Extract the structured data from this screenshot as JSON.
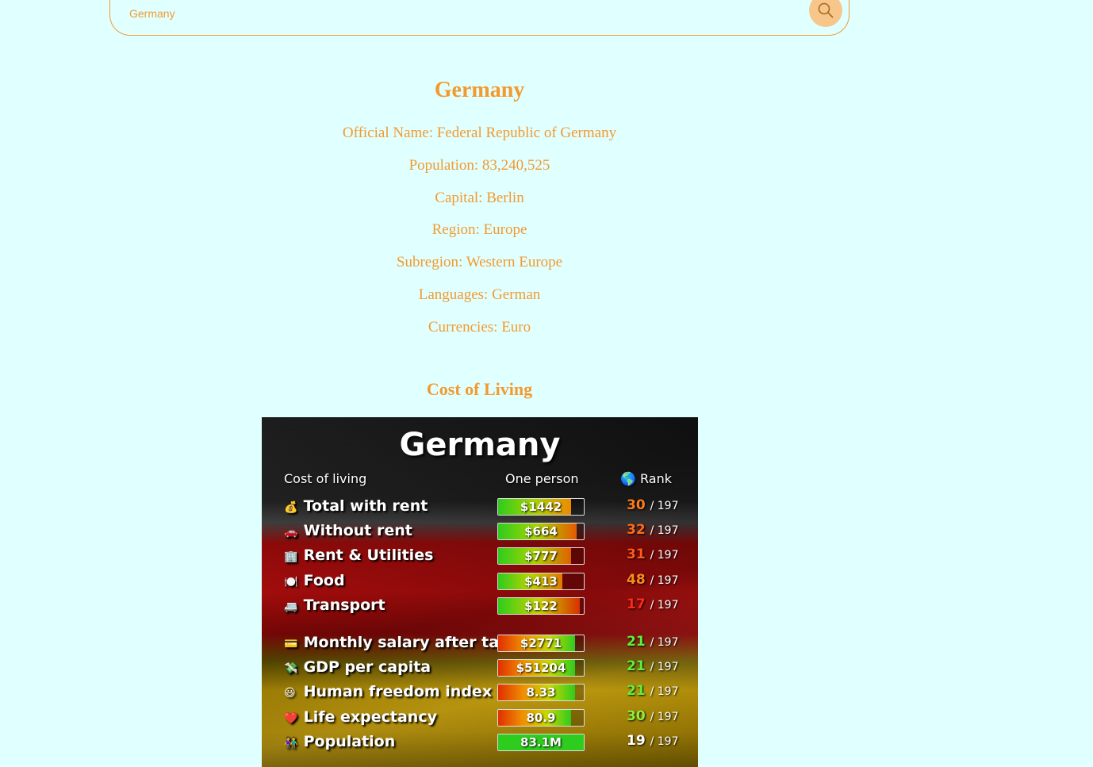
{
  "search": {
    "value": "Germany"
  },
  "country": {
    "name": "Germany",
    "official_name": "Official Name: Federal Republic of Germany",
    "population": "Population: 83,240,525",
    "capital": "Capital: Berlin",
    "region": "Region: Europe",
    "subregion": "Subregion: Western Europe",
    "languages": "Languages: German",
    "currencies": "Currencies: Euro"
  },
  "cost_section_title": "Cost of Living",
  "card": {
    "title": "Germany",
    "col_label": "Cost of living",
    "col_person": "One person",
    "col_rank": "Rank",
    "rows": [
      {
        "icon": "💰",
        "label": "Total with rent",
        "value": "$1442",
        "rank": "30",
        "of": "/ 197",
        "fill": 0.85,
        "rank_color": "#ff7a1a",
        "grad": "linear-gradient(90deg,#2ecc1e,#a8d400,#f08a00)"
      },
      {
        "icon": "🚗",
        "label": "Without rent",
        "value": "$664",
        "rank": "32",
        "of": "/ 197",
        "fill": 0.92,
        "rank_color": "#ff6a1a",
        "grad": "linear-gradient(90deg,#2ecc1e,#a8d400,#e55a00)"
      },
      {
        "icon": "🏢",
        "label": "Rent & Utilities",
        "value": "$777",
        "rank": "31",
        "of": "/ 197",
        "fill": 0.85,
        "rank_color": "#ff5a1a",
        "grad": "linear-gradient(90deg,#2ecc1e,#a8d400,#e06000)"
      },
      {
        "icon": "🍽️",
        "label": "Food",
        "value": "$413",
        "rank": "48",
        "of": "/ 197",
        "fill": 0.75,
        "rank_color": "#ff8c1a",
        "grad": "linear-gradient(90deg,#2ecc1e,#b8d400,#e07800)"
      },
      {
        "icon": "🚐",
        "label": "Transport",
        "value": "$122",
        "rank": "17",
        "of": "/ 197",
        "fill": 0.95,
        "rank_color": "#ff2a1a",
        "grad": "linear-gradient(90deg,#2ecc1e,#c8d400,#d83000)"
      },
      {
        "icon": "💳",
        "label": "Monthly salary after tax",
        "value": "$2771",
        "rank": "21",
        "of": "/ 197",
        "fill": 0.9,
        "rank_color": "#5ef03a",
        "grad": "linear-gradient(90deg,#e03000,#f09000,#c8d800,#2ecc1e)"
      },
      {
        "icon": "💸",
        "label": "GDP per capita",
        "value": "$51204",
        "rank": "21",
        "of": "/ 197",
        "fill": 0.9,
        "rank_color": "#5ef03a",
        "grad": "linear-gradient(90deg,#e03000,#f09000,#c8d800,#2ecc1e)"
      },
      {
        "icon": "😃",
        "label": "Human freedom index",
        "value": "8.33",
        "rank": "21",
        "of": "/ 197",
        "fill": 0.9,
        "rank_color": "#5ef03a",
        "grad": "linear-gradient(90deg,#e03000,#f09000,#c8d800,#2ecc1e)"
      },
      {
        "icon": "❤️",
        "label": "Life expectancy",
        "value": "80.9",
        "rank": "30",
        "of": "/ 197",
        "fill": 0.85,
        "rank_color": "#8ef03a",
        "grad": "linear-gradient(90deg,#e03000,#f09000,#c8d800,#2ecc1e)"
      },
      {
        "icon": "👫",
        "label": "Population",
        "value": "83.1M",
        "rank": "19",
        "of": "/ 197",
        "fill": 1.0,
        "rank_color": "#ffffff",
        "grad": "linear-gradient(90deg,#2ecc1e,#2ecc1e)"
      }
    ]
  }
}
